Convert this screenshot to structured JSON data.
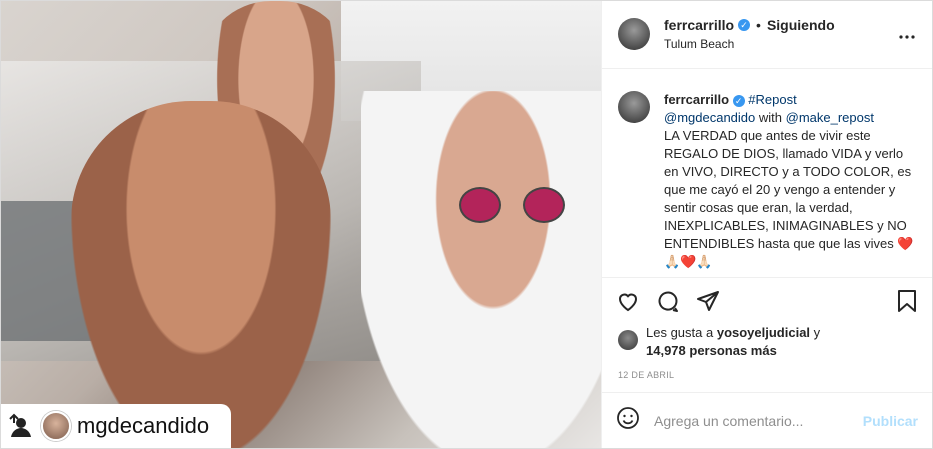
{
  "post": {
    "author": "ferrcarrillo",
    "follow_state": "Siguiendo",
    "location": "Tulum Beach",
    "separator": "•"
  },
  "photo": {
    "repost_handle": "mgdecandido"
  },
  "caption": {
    "username": "ferrcarrillo",
    "hashtag": "#Repost",
    "mention_1": "@mgdecandido",
    "with_word": "with",
    "mention_2": "@make_repost",
    "body": "LA VERDAD que antes de vivir este REGALO DE DIOS, llamado VIDA y verlo en VIVO, DIRECTO y a TODO COLOR, es que me cayó el 20 y vengo a entender y sentir cosas que eran, la verdad, INEXPLICABLES, INIMAGINABLES y NO ENTENDIBLES hasta que que las vives ❤️🙏🏻❤️🙏🏻"
  },
  "likes": {
    "prefix": "Les gusta a",
    "first_user": "yosoyeljudicial",
    "connector": "y",
    "count_text": "14,978 personas más"
  },
  "date": "12 DE ABRIL",
  "comment": {
    "placeholder": "Agrega un comentario...",
    "publish_label": "Publicar"
  },
  "colors": {
    "verified": "#3897f0",
    "link": "#00376b",
    "publish_disabled": "#b2dffc"
  },
  "icons": {
    "more": "more-horizontal-icon",
    "like": "heart-icon",
    "comment": "comment-icon",
    "share": "paper-plane-icon",
    "save": "bookmark-icon",
    "emoji": "smiley-icon",
    "repost": "repost-icon"
  }
}
